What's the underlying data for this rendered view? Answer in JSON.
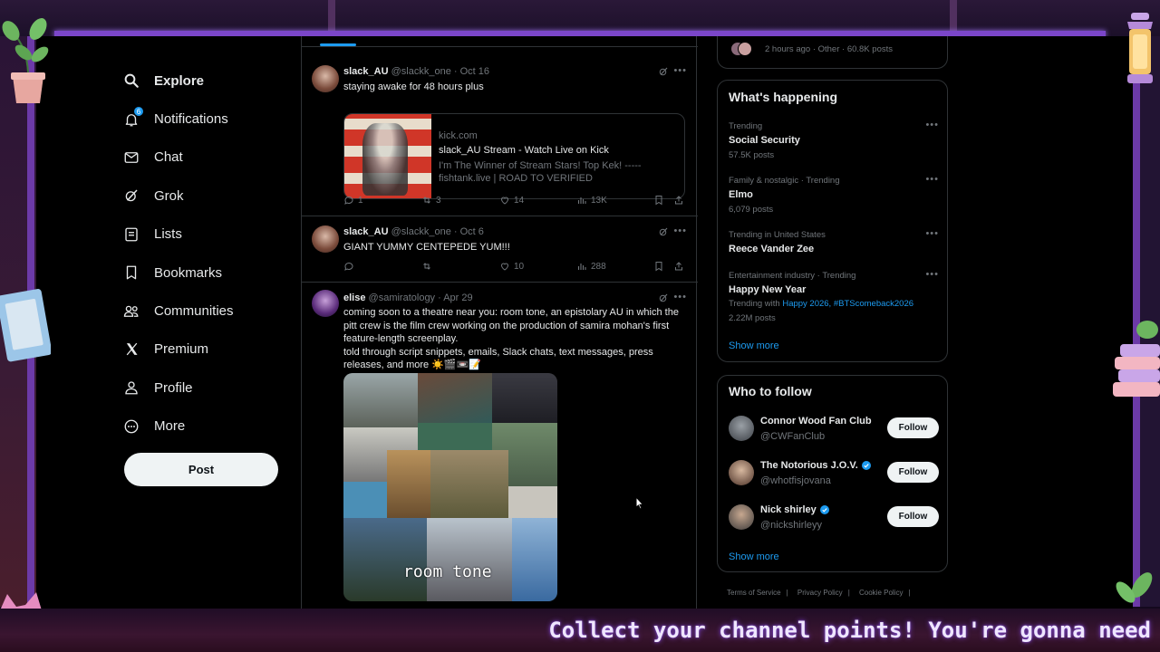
{
  "nav": {
    "items": [
      {
        "label": "Explore",
        "icon": "search-icon",
        "bold": true
      },
      {
        "label": "Notifications",
        "icon": "bell-icon",
        "badge": "6"
      },
      {
        "label": "Chat",
        "icon": "mail-icon"
      },
      {
        "label": "Grok",
        "icon": "grok-icon"
      },
      {
        "label": "Lists",
        "icon": "list-icon"
      },
      {
        "label": "Bookmarks",
        "icon": "bookmark-icon"
      },
      {
        "label": "Communities",
        "icon": "communities-icon"
      },
      {
        "label": "Premium",
        "icon": "x-logo-icon"
      },
      {
        "label": "Profile",
        "icon": "person-icon"
      },
      {
        "label": "More",
        "icon": "more-circle-icon"
      }
    ],
    "post_label": "Post"
  },
  "tweets": [
    {
      "name": "slack_AU",
      "handle": "@slackk_one · Oct 16",
      "text": "staying awake for 48 hours plus",
      "card": {
        "domain": "kick.com",
        "title": "slack_AU Stream - Watch Live on Kick",
        "desc": "I'm The Winner of Stream Stars! Top Kek! ----- fishtank.live | ROAD TO VERIFIED"
      },
      "replies": "1",
      "reposts": "3",
      "likes": "14",
      "views": "13K"
    },
    {
      "name": "slack_AU",
      "handle": "@slackk_one · Oct 6",
      "text": "GIANT YUMMY CENTEPEDE YUM!!!",
      "replies": "",
      "reposts": "",
      "likes": "10",
      "views": "288"
    },
    {
      "name": "elise",
      "handle": "@samiratology · Apr 29",
      "text_lines": [
        "coming soon to a theatre near you: room tone, an epistolary AU in which the pitt crew is the film crew working on the production of samira mohan's first feature-length screenplay.",
        "told through script snippets, emails, Slack chats, text messages, press releases, and more ☀️🎬📼📝"
      ],
      "image_text": "room tone"
    }
  ],
  "right": {
    "top_meta": "2 hours ago · Other · 60.8K posts",
    "whats_happening": {
      "title": "What's happening",
      "trends": [
        {
          "context": "Trending",
          "title": "Social Security",
          "count": "57.5K posts"
        },
        {
          "context": "Family & nostalgic · Trending",
          "title": "Elmo",
          "count": "6,079 posts"
        },
        {
          "context": "Trending in United States",
          "title": "Reece Vander Zee",
          "count": ""
        },
        {
          "context": "Entertainment industry · Trending",
          "title": "Happy New Year",
          "with_label": "Trending with",
          "with_tags": "Happy 2026, #BTScomeback2026",
          "count": "2.22M posts"
        }
      ],
      "show_more": "Show more"
    },
    "who_to_follow": {
      "title": "Who to follow",
      "accounts": [
        {
          "name": "Connor Wood Fan Club",
          "handle": "@CWFanClub",
          "verified": false,
          "button": "Follow"
        },
        {
          "name": "The Notorious J.O.V.",
          "handle": "@whotfisjovana",
          "verified": true,
          "button": "Follow"
        },
        {
          "name": "Nick shirley",
          "handle": "@nickshirleyy",
          "verified": true,
          "button": "Follow"
        }
      ],
      "show_more": "Show more"
    },
    "footer": [
      "Terms of Service",
      "Privacy Policy",
      "Cookie Policy"
    ]
  },
  "ticker_text": "Collect your channel points! You're gonna need",
  "colors": {
    "accent": "#1d9bf0",
    "overlay_purple": "#7b46c9",
    "background": "#000000"
  }
}
